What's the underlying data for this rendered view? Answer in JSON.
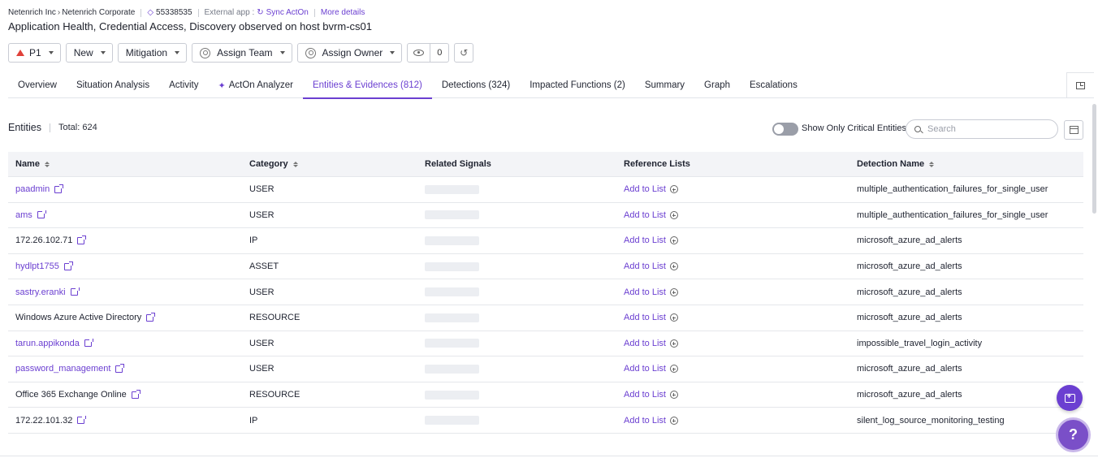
{
  "breadcrumb": {
    "org": "Netenrich Inc",
    "sub_org": "Netenrich Corporate",
    "ticket_id": "55338535",
    "external_app_label": "External app :",
    "sync_label": "Sync ActOn",
    "more_details": "More details"
  },
  "title": "Application Health, Credential Access, Discovery observed on host bvrm-cs01",
  "actions": {
    "priority": "P1",
    "status": "New",
    "stage": "Mitigation",
    "assign_team": "Assign Team",
    "assign_owner": "Assign Owner",
    "watchers_count": "0"
  },
  "tabs": [
    {
      "label": "Overview"
    },
    {
      "label": "Situation Analysis"
    },
    {
      "label": "Activity"
    },
    {
      "label": "ActOn Analyzer"
    },
    {
      "label": "Entities & Evidences (812)"
    },
    {
      "label": "Detections (324)"
    },
    {
      "label": "Impacted Functions (2)"
    },
    {
      "label": "Summary"
    },
    {
      "label": "Graph"
    },
    {
      "label": "Escalations"
    }
  ],
  "entities": {
    "title": "Entities",
    "total": "Total: 624",
    "toggle_label": "Show Only Critical Entities",
    "search_placeholder": "Search"
  },
  "table": {
    "headers": {
      "name": "Name",
      "category": "Category",
      "related_signals": "Related Signals",
      "reference_lists": "Reference Lists",
      "detection_name": "Detection Name"
    },
    "add_to_list": "Add to List",
    "rows": [
      {
        "name": "paadmin",
        "category": "USER",
        "detection": "multiple_authentication_failures_for_single_user"
      },
      {
        "name": "ams",
        "category": "USER",
        "detection": "multiple_authentication_failures_for_single_user"
      },
      {
        "name": "172.26.102.71",
        "category": "IP",
        "detection": "microsoft_azure_ad_alerts"
      },
      {
        "name": "hydlpt1755",
        "category": "ASSET",
        "detection": "microsoft_azure_ad_alerts"
      },
      {
        "name": "sastry.eranki",
        "category": "USER",
        "detection": "microsoft_azure_ad_alerts"
      },
      {
        "name": "Windows Azure Active Directory",
        "category": "RESOURCE",
        "detection": "microsoft_azure_ad_alerts"
      },
      {
        "name": "tarun.appikonda",
        "category": "USER",
        "detection": "impossible_travel_login_activity"
      },
      {
        "name": "password_management",
        "category": "USER",
        "detection": "microsoft_azure_ad_alerts"
      },
      {
        "name": "Office 365 Exchange Online",
        "category": "RESOURCE",
        "detection": "microsoft_azure_ad_alerts"
      },
      {
        "name": "172.22.101.32",
        "category": "IP",
        "detection": "silent_log_source_monitoring_testing"
      }
    ]
  },
  "colors": {
    "accent": "#6b3fd1",
    "priority_red": "#e0413a"
  },
  "icons": [
    "tag-icon",
    "sync-icon",
    "priority-arrow-icon",
    "avatar-icon",
    "eye-icon",
    "history-icon",
    "sparkle-icon",
    "panel-icon",
    "search-icon",
    "column-settings-icon",
    "external-link-icon",
    "plus-circle-icon",
    "chat-icon",
    "help-icon"
  ]
}
